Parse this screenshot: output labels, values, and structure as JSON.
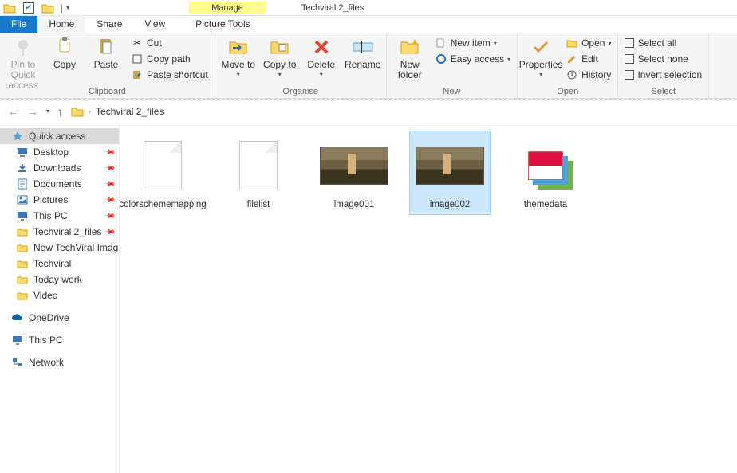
{
  "window": {
    "context_tab": "Manage",
    "location_title": "Techviral 2_files"
  },
  "tabs": {
    "file": "File",
    "home": "Home",
    "share": "Share",
    "view": "View",
    "picture_tools": "Picture Tools"
  },
  "ribbon": {
    "clipboard": {
      "label": "Clipboard",
      "pin": "Pin to Quick access",
      "copy": "Copy",
      "paste": "Paste",
      "cut": "Cut",
      "copy_path": "Copy path",
      "paste_shortcut": "Paste shortcut"
    },
    "organise": {
      "label": "Organise",
      "move_to": "Move to",
      "copy_to": "Copy to",
      "delete": "Delete",
      "rename": "Rename"
    },
    "new": {
      "label": "New",
      "new_folder": "New folder",
      "new_item": "New item",
      "easy_access": "Easy access"
    },
    "open": {
      "label": "Open",
      "properties": "Properties",
      "open": "Open",
      "edit": "Edit",
      "history": "History"
    },
    "select": {
      "label": "Select",
      "select_all": "Select all",
      "select_none": "Select none",
      "invert": "Invert selection"
    }
  },
  "nav": {
    "folder": "Techviral 2_files"
  },
  "sidebar": {
    "quick_access": "Quick access",
    "items": [
      {
        "label": "Desktop",
        "pinned": true,
        "icon": "desktop"
      },
      {
        "label": "Downloads",
        "pinned": true,
        "icon": "downloads"
      },
      {
        "label": "Documents",
        "pinned": true,
        "icon": "documents"
      },
      {
        "label": "Pictures",
        "pinned": true,
        "icon": "pictures"
      },
      {
        "label": "This PC",
        "pinned": true,
        "icon": "pc"
      },
      {
        "label": "Techviral 2_files",
        "pinned": true,
        "icon": "folder"
      },
      {
        "label": "New TechViral Imag",
        "pinned": false,
        "icon": "folder"
      },
      {
        "label": "Techviral",
        "pinned": false,
        "icon": "folder"
      },
      {
        "label": "Today work",
        "pinned": false,
        "icon": "folder"
      },
      {
        "label": "Video",
        "pinned": false,
        "icon": "folder"
      }
    ],
    "onedrive": "OneDrive",
    "this_pc": "This PC",
    "network": "Network"
  },
  "files": [
    {
      "name": "colorschememapping",
      "type": "doc",
      "selected": false
    },
    {
      "name": "filelist",
      "type": "doc",
      "selected": false
    },
    {
      "name": "image001",
      "type": "img",
      "selected": false
    },
    {
      "name": "image002",
      "type": "img",
      "selected": true
    },
    {
      "name": "themedata",
      "type": "xml",
      "selected": false
    }
  ]
}
